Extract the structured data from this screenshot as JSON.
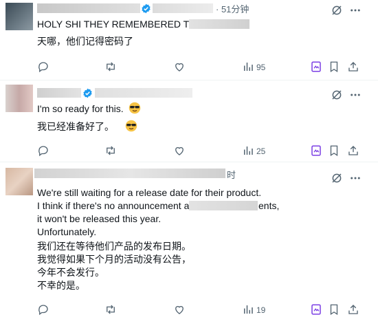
{
  "tweets": [
    {
      "time_suffix": "· 51分钟",
      "lines": [
        "HOLY SHI THEY REMEMBERED THE"
      ],
      "translation": [
        "天哪，他们记得密码了"
      ],
      "views": "95"
    },
    {
      "lines": [
        "I'm so ready for this."
      ],
      "translation": [
        "我已经准备好了。"
      ],
      "views": "25"
    },
    {
      "time_suffix": "时",
      "lines": [
        "We're still waiting for a release date for their product.",
        "I think if there's no announcement a",
        "ents,",
        "it won't be released this year.",
        "Unfortunately."
      ],
      "translation": [
        "我们还在等待他们产品的发布日期。",
        "我觉得如果下个月的活动没有公告，",
        "今年不会发行。",
        "不幸的是。"
      ],
      "views": "19"
    }
  ],
  "colors": {
    "icon": "#536471",
    "grok": "#7b3fe4",
    "verified": "#1d9bf0"
  },
  "icons": [
    "grok-icon",
    "more-icon",
    "reply-icon",
    "retweet-icon",
    "like-icon",
    "views-icon",
    "image-icon",
    "bookmark-icon",
    "share-icon"
  ]
}
